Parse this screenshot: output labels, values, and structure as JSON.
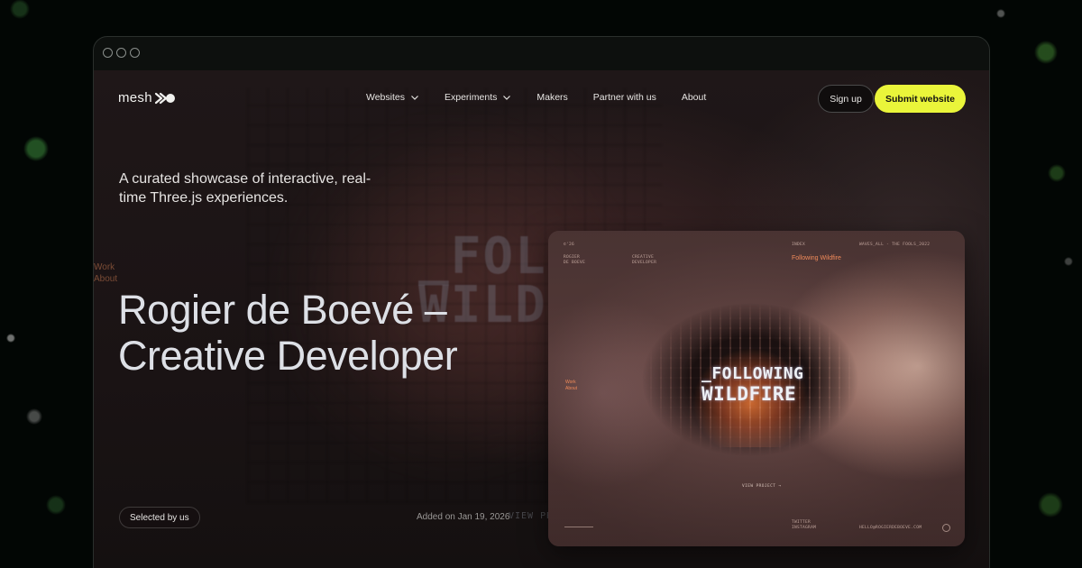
{
  "nav": {
    "logo": "mesh",
    "items": [
      {
        "label": "Websites",
        "has_dropdown": true
      },
      {
        "label": "Experiments",
        "has_dropdown": true
      },
      {
        "label": "Makers",
        "has_dropdown": false
      },
      {
        "label": "Partner with us",
        "has_dropdown": false
      },
      {
        "label": "About",
        "has_dropdown": false
      }
    ],
    "signup_label": "Sign up",
    "submit_label": "Submit website"
  },
  "hero": {
    "tagline": "A curated showcase of interactive, real-time Three.js experiences.",
    "title_line1": "Rogier de Boevé –",
    "title_line2": "Creative Developer",
    "badge": "Selected by us",
    "added": "Added on Jan 19, 2026"
  },
  "background": {
    "title_line1": "_FOLLO",
    "title_line2": "WILDF",
    "side_line1": "Work",
    "side_line2": "About",
    "view": "VIEW PRO"
  },
  "preview": {
    "title_line1": "_FOLLOWING",
    "title_line2": "WILDFIRE",
    "top_left": "©'26",
    "top_col2_line1": "ROGIER",
    "top_col2_line2": "DE BOEVE",
    "top_col3_line1": "CREATIVE",
    "top_col3_line2": "DEVELOPER",
    "top_col4": "INDEX",
    "top_col5": "WAVES_ALL - THE FOOLS_2022",
    "accent": "Following Wildfire",
    "side_line1": "Work",
    "side_line2": "About",
    "view": "VIEW PROJECT →",
    "bottom_col1_line1": "TWITTER",
    "bottom_col1_line2": "INSTAGRAM",
    "bottom_col2": "HELLO@ROGIERDEBOEVE.COM"
  },
  "colors": {
    "accent": "#eaf53a",
    "preview_accent": "#f08a5a"
  }
}
